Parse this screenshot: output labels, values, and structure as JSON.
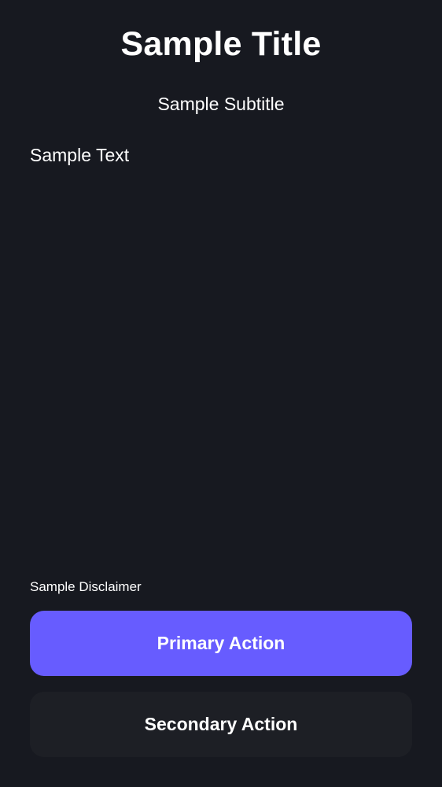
{
  "header": {
    "title": "Sample Title",
    "subtitle": "Sample Subtitle"
  },
  "content": {
    "text": "Sample Text"
  },
  "footer": {
    "disclaimer": "Sample Disclaimer",
    "primary_action_label": "Primary Action",
    "secondary_action_label": "Secondary Action"
  },
  "colors": {
    "background": "#171920",
    "text": "#ffffff",
    "accent": "#675cff",
    "secondary_button": "#1d1f25"
  }
}
